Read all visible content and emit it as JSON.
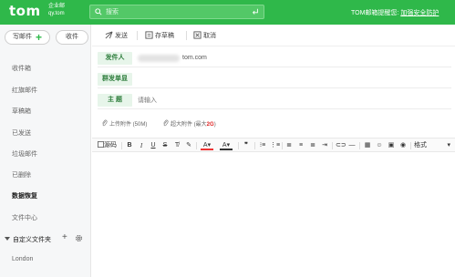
{
  "brand": {
    "logo": "tom",
    "sub_top": "企业邮",
    "sub_bottom": "qy.tom"
  },
  "search": {
    "placeholder": "搜索"
  },
  "header": {
    "notice": "TOM邮箱提醒您:",
    "notice_link": "加强安全防护"
  },
  "sidebar": {
    "write_label": "写邮件",
    "receive_label": "收件",
    "items": [
      {
        "label": "收件箱"
      },
      {
        "label": "红旗邮件"
      },
      {
        "label": "草稿箱"
      },
      {
        "label": "已发送"
      },
      {
        "label": "垃圾邮件"
      },
      {
        "label": "已删除"
      },
      {
        "label": "数据恢复"
      },
      {
        "label": "文件中心"
      }
    ],
    "custom_folder_label": "自定义文件夹",
    "folders": [
      {
        "label": "London"
      }
    ]
  },
  "toolbar": {
    "send_label": "发送",
    "draft_label": "存草稿",
    "cancel_label": "取消"
  },
  "compose": {
    "from_label": "发件人",
    "from_domain": "tom.com",
    "bulk_label": "群发单显",
    "subject_label": "主  题",
    "subject_placeholder": "请输入"
  },
  "attachments": {
    "upload_label": "上传附件 (50M)",
    "large_prefix": "超大附件 (最大",
    "large_size": "2G",
    "large_suffix": ")"
  },
  "editor": {
    "source_label": "源码",
    "format_label": "格式"
  },
  "colors": {
    "brand_green": "#2fb84a",
    "label_bg": "#e7f5ea",
    "label_text": "#2e7d3c"
  }
}
